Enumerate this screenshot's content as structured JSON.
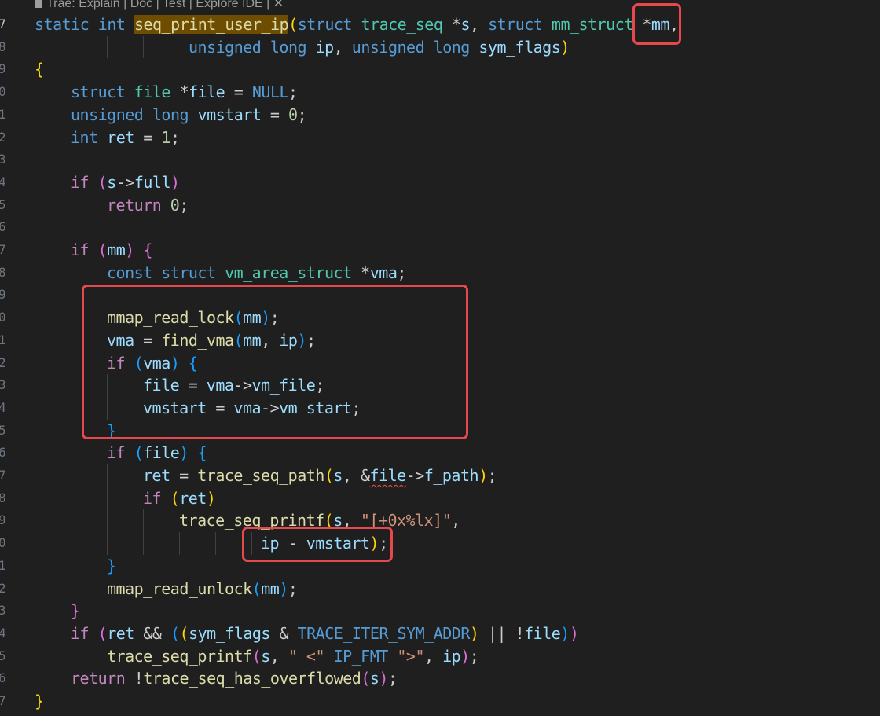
{
  "codelens": {
    "text": "Trae: Explain | Doc | Test | Explore IDE | ✕"
  },
  "line_numbers": [
    "7",
    "8",
    "9",
    "0",
    "1",
    "2",
    "3",
    "4",
    "5",
    "6",
    "7",
    "8",
    "9",
    "0",
    "1",
    "2",
    "3",
    "4",
    "5",
    "6",
    "7",
    "8",
    "9",
    "0",
    "1",
    "2",
    "3",
    "4",
    "5",
    "6",
    "7"
  ],
  "code": {
    "l1_static": "static",
    "l1_int": "int",
    "l1_fn": "seq_print_user_ip",
    "l1_open": "(",
    "l1_struct": "struct",
    "l1_type": "trace_seq",
    "l1_star": " *",
    "l1_s": "s",
    "l1_comma": ", ",
    "l1_struct2": "struct",
    "l1_type2": "mm_struct",
    "l1_star2": " *",
    "l1_mm": "mm",
    "l1_end": ",",
    "l2_unsigned": "unsigned",
    "l2_long": "long",
    "l2_ip": "ip",
    "l2_comma": ", ",
    "l2_unsigned2": "unsigned",
    "l2_long2": "long",
    "l2_sym": "sym_flags",
    "l2_close": ")",
    "l3": "{",
    "l4_struct": "struct",
    "l4_file": "file",
    "l4_star": " *",
    "l4_var": "file",
    "l4_eq": " = ",
    "l4_null": "NULL",
    "l4_semi": ";",
    "l5_unsigned": "unsigned",
    "l5_long": "long",
    "l5_var": "vmstart",
    "l5_eq": " = ",
    "l5_zero": "0",
    "l5_semi": ";",
    "l6_int": "int",
    "l6_var": "ret",
    "l6_eq": " = ",
    "l6_one": "1",
    "l6_semi": ";",
    "l8_if": "if",
    "l8_open": "(",
    "l8_s": "s",
    "l8_arrow": "->",
    "l8_full": "full",
    "l8_close": ")",
    "l9_return": "return",
    "l9_zero": "0",
    "l9_semi": ";",
    "l11_if": "if",
    "l11_open": "(",
    "l11_mm": "mm",
    "l11_close": ")",
    "l11_brace": "{",
    "l12_const": "const",
    "l12_struct": "struct",
    "l12_type": "vm_area_struct",
    "l12_star": " *",
    "l12_vma": "vma",
    "l12_semi": ";",
    "l14_fn": "mmap_read_lock",
    "l14_open": "(",
    "l14_mm": "mm",
    "l14_close": ")",
    "l14_semi": ";",
    "l15_vma": "vma",
    "l15_eq": " = ",
    "l15_fn": "find_vma",
    "l15_open": "(",
    "l15_mm": "mm",
    "l15_comma": ", ",
    "l15_ip": "ip",
    "l15_close": ")",
    "l15_semi": ";",
    "l16_if": "if",
    "l16_open": "(",
    "l16_vma": "vma",
    "l16_close": ")",
    "l16_brace": "{",
    "l17_file": "file",
    "l17_eq": " = ",
    "l17_vma": "vma",
    "l17_arrow": "->",
    "l17_field": "vm_file",
    "l17_semi": ";",
    "l18_var": "vmstart",
    "l18_eq": " = ",
    "l18_vma": "vma",
    "l18_arrow": "->",
    "l18_field": "vm_start",
    "l18_semi": ";",
    "l19_brace": "}",
    "l20_if": "if",
    "l20_open": "(",
    "l20_file": "file",
    "l20_close": ")",
    "l20_brace": "{",
    "l21_ret": "ret",
    "l21_eq": " = ",
    "l21_fn": "trace_seq_path",
    "l21_open": "(",
    "l21_s": "s",
    "l21_comma": ", &",
    "l21_file": "file",
    "l21_arrow": "->",
    "l21_field": "f_path",
    "l21_close": ")",
    "l21_semi": ";",
    "l22_if": "if",
    "l22_open": "(",
    "l22_ret": "ret",
    "l22_close": ")",
    "l23_fn": "trace_seq_printf",
    "l23_open": "(",
    "l23_s": "s",
    "l23_comma": ", ",
    "l23_str": "\"[+0x%lx]\"",
    "l23_end": ",",
    "l24_ip": "ip",
    "l24_minus": " - ",
    "l24_var": "vmstart",
    "l24_close": ")",
    "l24_semi": ";",
    "l25_brace": "}",
    "l26_fn": "mmap_read_unlock",
    "l26_open": "(",
    "l26_mm": "mm",
    "l26_close": ")",
    "l26_semi": ";",
    "l27_brace": "}",
    "l28_if": "if",
    "l28_open": "(",
    "l28_ret": "ret",
    "l28_and": " && ",
    "l28_open2": "(",
    "l28_open3": "(",
    "l28_sym": "sym_flags",
    "l28_amp": " & ",
    "l28_const": "TRACE_ITER_SYM_ADDR",
    "l28_close3": ")",
    "l28_or": " || !",
    "l28_file": "file",
    "l28_close2": ")",
    "l28_close": ")",
    "l29_fn": "trace_seq_printf",
    "l29_open": "(",
    "l29_s": "s",
    "l29_comma": ", ",
    "l29_str1": "\" <\"",
    "l29_sp1": " ",
    "l29_mac": "IP_FMT",
    "l29_sp2": " ",
    "l29_str2": "\">\"",
    "l29_comma2": ", ",
    "l29_ip": "ip",
    "l29_close": ")",
    "l29_semi": ";",
    "l30_return": "return",
    "l30_not": " !",
    "l30_fn": "trace_seq_has_overflowed",
    "l30_open": "(",
    "l30_s": "s",
    "l30_close": ")",
    "l30_semi": ";",
    "l31_brace": "}"
  },
  "colors": {
    "background": "#1f1f1f",
    "keyword": "#569cd6",
    "type": "#4ec9b0",
    "function": "#dcdcaa",
    "variable": "#9cdcfe",
    "number": "#b5cea8",
    "string": "#ce9178",
    "control": "#c586c0",
    "highlight_box": "#e5484d"
  }
}
